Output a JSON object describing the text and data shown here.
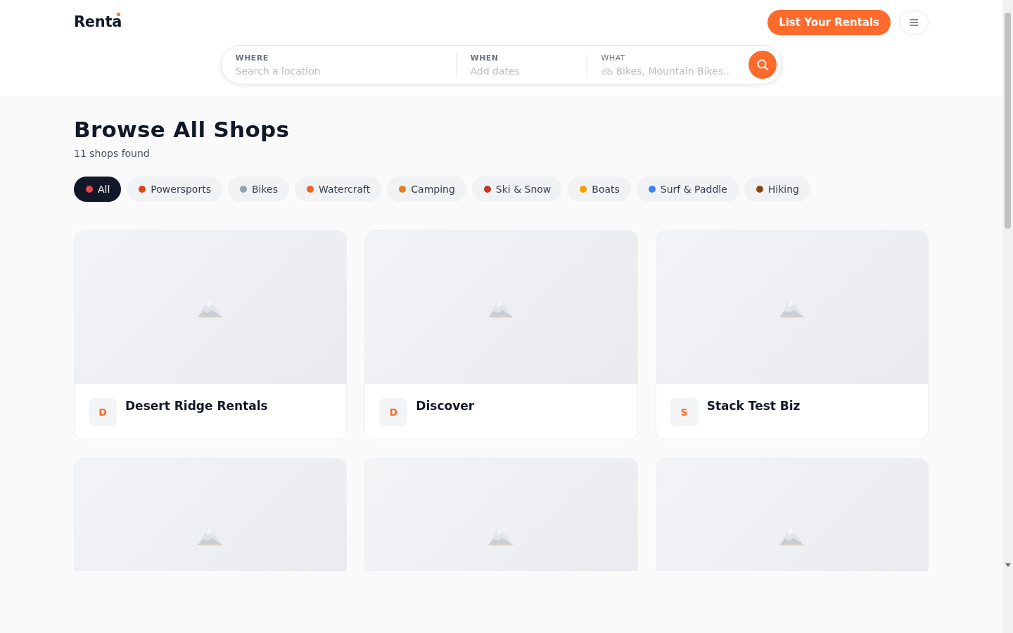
{
  "header": {
    "logo": "Renta",
    "cta": "List Your Rentals"
  },
  "search": {
    "fields": [
      {
        "label": "WHERE",
        "placeholder": "Search a location"
      },
      {
        "label": "WHEN",
        "placeholder": "Add dates"
      },
      {
        "label": "WHAT",
        "placeholder": "Bikes, Mountain Bikes..",
        "kind": "bike"
      }
    ]
  },
  "title": "Browse All Shops",
  "count": "11 shops found",
  "categories": [
    {
      "label": "All",
      "selected": true,
      "color": "#e5484d"
    },
    {
      "label": "Powersports",
      "selected": false,
      "color": "#d9480f"
    },
    {
      "label": "Bikes",
      "selected": false,
      "color": "#8aa4b8"
    },
    {
      "label": "Watercraft",
      "selected": false,
      "color": "#f26522"
    },
    {
      "label": "Camping",
      "selected": false,
      "color": "#e67e22"
    },
    {
      "label": "Ski & Snow",
      "selected": false,
      "color": "#c0392b"
    },
    {
      "label": "Boats",
      "selected": false,
      "color": "#f59f00"
    },
    {
      "label": "Surf & Paddle",
      "selected": false,
      "color": "#3b82f6"
    },
    {
      "label": "Hiking",
      "selected": false,
      "color": "#8b4513"
    }
  ],
  "shops": [
    {
      "kind": "card",
      "initial": "D",
      "name": "Desert Ridge Rentals"
    },
    {
      "kind": "card",
      "initial": "D",
      "name": "Discover"
    },
    {
      "kind": "card",
      "initial": "S",
      "name": "Stack Test Biz"
    },
    {
      "kind": "picture"
    },
    {
      "kind": "picture"
    },
    {
      "kind": "picture"
    }
  ]
}
